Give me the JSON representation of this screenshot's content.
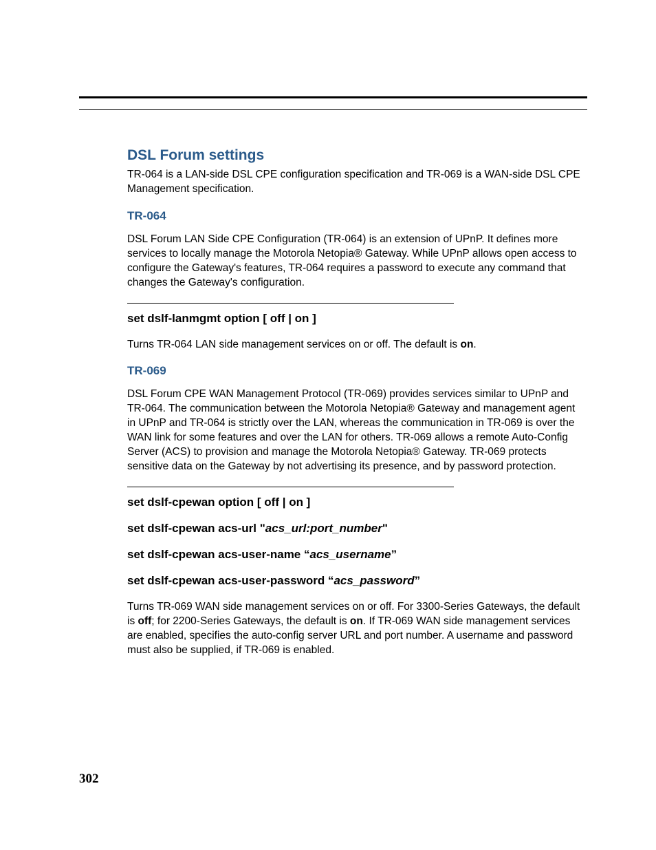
{
  "page_number": "302",
  "section": {
    "title": "DSL Forum settings",
    "intro": "TR-064 is a LAN-side DSL CPE configuration specification and TR-069 is a WAN-side DSL CPE Management specification."
  },
  "tr064": {
    "heading": "TR-064",
    "body": "DSL Forum LAN Side CPE Configuration (TR-064) is an extension of UPnP. It defines more services to locally manage the Motorola Netopia® Gateway. While UPnP allows open access to configure the Gateway's features, TR-064 requires a password to execute any command that changes the Gateway's configuration.",
    "cmd1": "set dslf-lanmgmt option [ off | on ]",
    "desc_pre": "Turns TR-064 LAN side management services on or off. The default is ",
    "desc_bold": "on",
    "desc_post": "."
  },
  "tr069": {
    "heading": "TR-069",
    "body": "DSL Forum CPE WAN Management Protocol (TR-069) provides services similar to UPnP and TR-064. The communication between the Motorola Netopia® Gateway and management agent in UPnP and TR-064 is strictly over the LAN, whereas the communication in TR-069 is over the WAN link for some features and over the LAN for others. TR-069 allows a remote Auto-Config Server (ACS) to provision and manage the Motorola Netopia® Gateway. TR-069 protects sensitive data on the Gateway by not advertising its presence, and by password protection.",
    "cmd1": "set dslf-cpewan option [ off | on ]",
    "cmd2_pre": "set dslf-cpewan acs-url \"",
    "cmd2_param": "acs_url:port_number",
    "cmd2_post": "\"",
    "cmd3_pre": "set dslf-cpewan acs-user-name “",
    "cmd3_param": "acs_username",
    "cmd3_post": "”",
    "cmd4_pre": "set dslf-cpewan acs-user-password “",
    "cmd4_param": "acs_password",
    "cmd4_post": "”",
    "desc_1": "Turns TR-069 WAN side management services on or off. For 3300-Series Gateways, the default is ",
    "desc_off": "off",
    "desc_2": "; for 2200-Series Gateways, the default is ",
    "desc_on": "on",
    "desc_3": ". If TR-069 WAN side management services are enabled, specifies the auto-config server URL and port number. A username and password must also be supplied, if TR-069 is enabled."
  }
}
